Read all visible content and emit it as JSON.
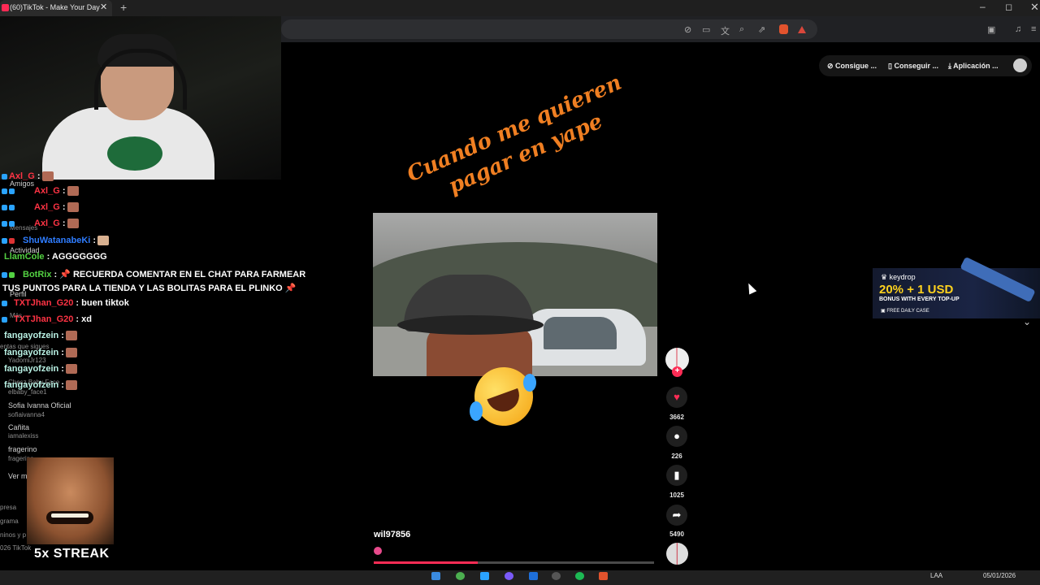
{
  "browser": {
    "tab_title": "(60)TikTok - Make Your Day",
    "tab_close": "✕",
    "new_tab": "+",
    "window_controls": {
      "minimize": "–",
      "maximize": "◻",
      "close": "✕"
    },
    "toolbar_icons": [
      "mute-icon",
      "cast-icon",
      "translate-icon",
      "zoom-icon",
      "share-icon",
      "brave-shields-icon",
      "brave-rewards-icon",
      "sidebar-icon",
      "media-icon",
      "menu-icon"
    ]
  },
  "tiktok_header": {
    "coins_button": "Consigue ...",
    "get_app_button": "Conseguir ...",
    "app_button": "Aplicación ..."
  },
  "sidebar": {
    "amigos": "Amigos",
    "mensajes": "Mensajes",
    "actividad": "Actividad",
    "perfil": "Perfil",
    "mas": "Más",
    "following_header": "entas que sigues",
    "following": [
      {
        "name": "YadomiJr123",
        "handle": ""
      },
      {
        "name": "Chesz Baby Face",
        "handle": "elbaby_face1"
      },
      {
        "name": "Sofia  Ivanna Oficial",
        "handle": "sofiaivanna4"
      },
      {
        "name": "Cañita",
        "handle": "iamalexiss"
      },
      {
        "name": "fragerino",
        "handle": "fragerino"
      }
    ],
    "ver_mas": "Ver m",
    "footer": [
      "presa",
      "grama",
      "ninos y p",
      "026 TikTok"
    ]
  },
  "chat": [
    {
      "user": "Axl_G",
      "text": ":",
      "color": "#ff3344"
    },
    {
      "user": "Axl_G",
      "text": ":",
      "color": "#ff3344"
    },
    {
      "user": "Axl_G",
      "text": ":",
      "color": "#ff3344"
    },
    {
      "user": "Axl_G",
      "text": ":",
      "color": "#ff3344"
    },
    {
      "user": "ShuWatanabeKi",
      "text": ":",
      "color": "#2f7dff"
    },
    {
      "user": "LlamCole",
      "text": ": AGGGGGGG",
      "color": "#53d142"
    },
    {
      "user": "BotRix",
      "text": ": 📌 RECUERDA COMENTAR EN EL CHAT PARA FARMEAR",
      "color": "#53d142"
    },
    {
      "user": "",
      "text": "TUS PUNTOS PARA LA TIENDA Y LAS BOLITAS PARA EL PLINKO 📌",
      "color": "#fff"
    },
    {
      "user": "TXTJhan_G20",
      "text": ": buen tiktok",
      "color": "#ff3344"
    },
    {
      "user": "TXTJhan_G20",
      "text": ": xd",
      "color": "#ff3344"
    },
    {
      "user": "fangayofzein",
      "text": ":",
      "color": "#b9f1e4"
    },
    {
      "user": "fangayofzein",
      "text": ":",
      "color": "#b9f1e4"
    },
    {
      "user": "fangayofzein",
      "text": ":",
      "color": "#b9f1e4"
    },
    {
      "user": "fangayofzein",
      "text": ":",
      "color": "#b9f1e4"
    }
  ],
  "streak_label": "5x STREAK",
  "video": {
    "caption": "Cuando me quieren pagar en yape",
    "username": "wil97856",
    "progress": 0.37
  },
  "actions": {
    "follow": "+",
    "likes": "3662",
    "comments": "226",
    "saves": "1025",
    "shares": "5490"
  },
  "ad": {
    "brand": "keydrop",
    "headline": "20% + 1 USD",
    "subline": "BONUS WITH EVERY TOP-UP",
    "cta": "FREE DAILY CASE",
    "collapse": "⌄"
  },
  "taskbar": {
    "language": "LAA",
    "date": "05/01/2026"
  },
  "colors": {
    "tiktok_red": "#fe2c55",
    "caption_orange": "#f07f22",
    "ad_yellow": "#ffd21e"
  }
}
